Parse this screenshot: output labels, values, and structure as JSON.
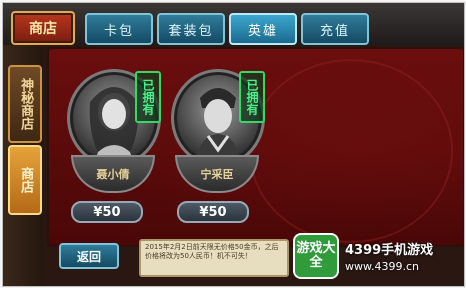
{
  "shop": {
    "title": "商店"
  },
  "tabs": [
    {
      "label": "卡包",
      "active": false
    },
    {
      "label": "套装包",
      "active": false
    },
    {
      "label": "英雄",
      "active": true
    },
    {
      "label": "充值",
      "active": false
    }
  ],
  "sidebar": {
    "items": [
      {
        "label": "神秘商店",
        "active": false
      },
      {
        "label": "商店",
        "active": true
      }
    ]
  },
  "heroes": [
    {
      "name": "聂小倩",
      "status": "已拥有",
      "price": "¥50",
      "icon": "female-warrior-portrait-icon"
    },
    {
      "name": "宁采臣",
      "status": "已拥有",
      "price": "¥50",
      "icon": "scholar-portrait-icon"
    }
  ],
  "footer": {
    "back_label": "返回",
    "notice": "2015年2月2日前天限无价格50金币，之后价格将改为50人民币！机不可失！"
  },
  "watermark": {
    "logo_text": "游戏大全",
    "brand": "4399手机游戏",
    "url": "www.4399.cn"
  },
  "colors": {
    "panel_red": "#6b0e0e",
    "tab_blue": "#2f7c9a",
    "owned_green": "#36d66a",
    "gold": "#e5a94f"
  }
}
